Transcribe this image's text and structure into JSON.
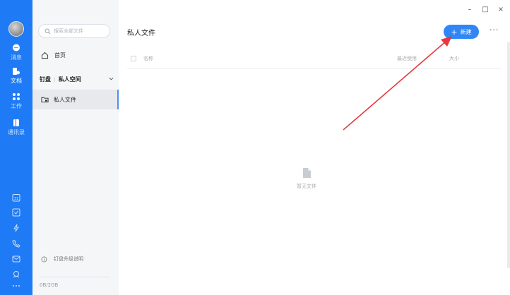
{
  "window": {
    "min": "–",
    "max": "□",
    "close": "×"
  },
  "rail": {
    "items": [
      {
        "label": "消息",
        "icon": "chat-icon"
      },
      {
        "label": "文档",
        "icon": "document-icon",
        "active": true
      },
      {
        "label": "工作",
        "icon": "grid-icon"
      },
      {
        "label": "通讯录",
        "icon": "contacts-icon"
      }
    ],
    "bottom_icons": [
      "calendar-icon",
      "todo-icon",
      "lightning-icon",
      "phone-icon",
      "mail-icon",
      "cloud-icon",
      "more-dots-icon"
    ]
  },
  "sidebar": {
    "search_placeholder": "搜索全部文件",
    "home": "首页",
    "space_owner": "钉盘",
    "space_name": "私人空间",
    "private_files": "私人文件",
    "upgrade": "钉盘升级说明",
    "storage": "0B/2GB"
  },
  "main": {
    "title": "私人文件",
    "new_button": "新建",
    "more": "···",
    "columns": {
      "name": "名称",
      "recent": "最近使用",
      "size": "大小"
    },
    "empty_text": "暂无文件"
  },
  "colors": {
    "rail": "#1f7bf5",
    "accent": "#2f86f6",
    "annotation": "#e8383d"
  }
}
